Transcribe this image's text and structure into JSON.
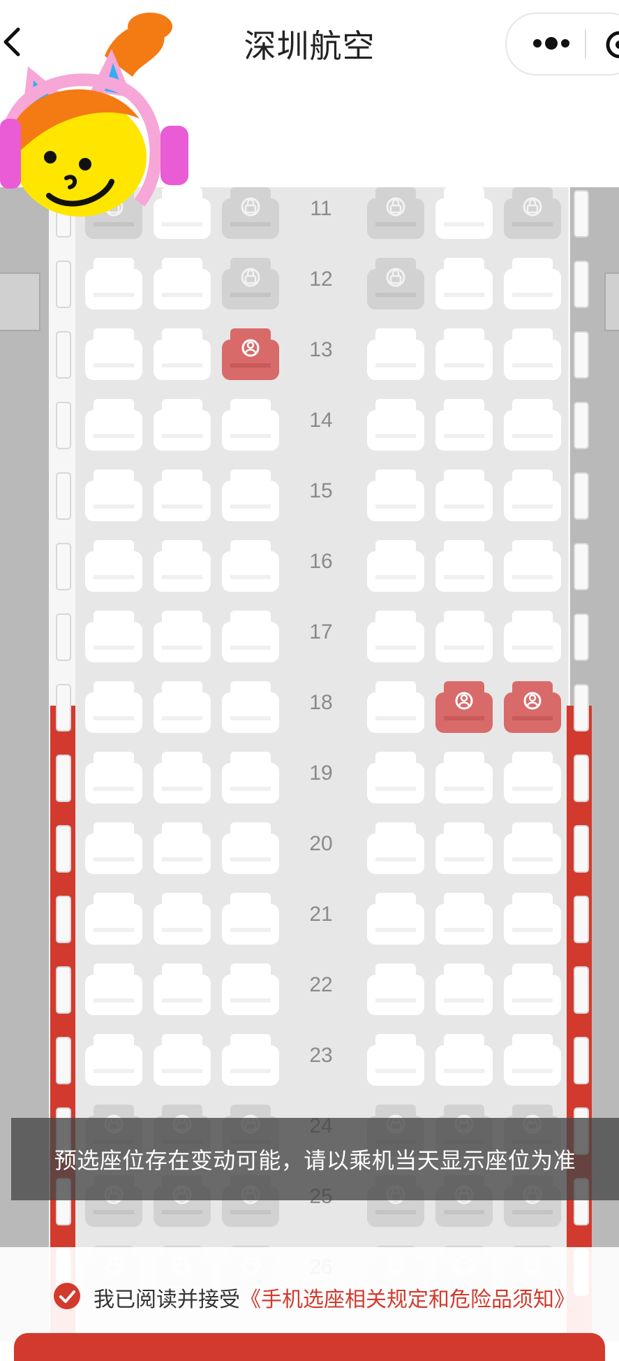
{
  "header": {
    "title": "深圳航空",
    "back_icon": "chevron-left-icon",
    "more_icon": "more-dots-icon",
    "close_icon": "target-close-icon"
  },
  "seat_map": {
    "rows": [
      {
        "num": "11",
        "seats": [
          "locked",
          "available",
          "locked",
          "locked",
          "available",
          "locked"
        ]
      },
      {
        "num": "12",
        "seats": [
          "available",
          "available",
          "locked",
          "locked",
          "available",
          "available"
        ]
      },
      {
        "num": "13",
        "seats": [
          "available",
          "available",
          "occupied",
          "available",
          "available",
          "available"
        ]
      },
      {
        "num": "14",
        "seats": [
          "available",
          "available",
          "available",
          "available",
          "available",
          "available"
        ]
      },
      {
        "num": "15",
        "seats": [
          "available",
          "available",
          "available",
          "available",
          "available",
          "available"
        ]
      },
      {
        "num": "16",
        "seats": [
          "available",
          "available",
          "available",
          "available",
          "available",
          "available"
        ]
      },
      {
        "num": "17",
        "seats": [
          "available",
          "available",
          "available",
          "available",
          "available",
          "available"
        ]
      },
      {
        "num": "18",
        "seats": [
          "available",
          "available",
          "available",
          "available",
          "occupied",
          "occupied"
        ]
      },
      {
        "num": "19",
        "seats": [
          "available",
          "available",
          "available",
          "available",
          "available",
          "available"
        ]
      },
      {
        "num": "20",
        "seats": [
          "available",
          "available",
          "available",
          "available",
          "available",
          "available"
        ]
      },
      {
        "num": "21",
        "seats": [
          "available",
          "available",
          "available",
          "available",
          "available",
          "available"
        ]
      },
      {
        "num": "22",
        "seats": [
          "available",
          "available",
          "available",
          "available",
          "available",
          "available"
        ]
      },
      {
        "num": "23",
        "seats": [
          "available",
          "available",
          "available",
          "available",
          "available",
          "available"
        ]
      },
      {
        "num": "24",
        "seats": [
          "locked",
          "locked",
          "locked",
          "locked",
          "locked",
          "locked"
        ]
      },
      {
        "num": "25",
        "seats": [
          "locked",
          "locked",
          "locked",
          "locked",
          "locked",
          "locked"
        ]
      },
      {
        "num": "26",
        "seats": [
          "locked",
          "locked",
          "locked",
          "locked",
          "locked",
          "locked"
        ]
      }
    ],
    "legend_icons": {
      "occupied": "person-icon",
      "locked": "lock-icon"
    },
    "colors": {
      "occupied": "#d96a6a",
      "exit_stripe": "#d23a2e",
      "available": "#ffffff",
      "locked": "#d2d2d2"
    }
  },
  "notice": {
    "text": "预选座位存在变动可能，请以乘机当天显示座位为准"
  },
  "footer": {
    "agree_prefix": "我已阅读并接受",
    "agree_link": "《手机选座相关规定和危险品须知》",
    "check_icon": "check-circle-icon",
    "accent": "#d23a2e"
  }
}
